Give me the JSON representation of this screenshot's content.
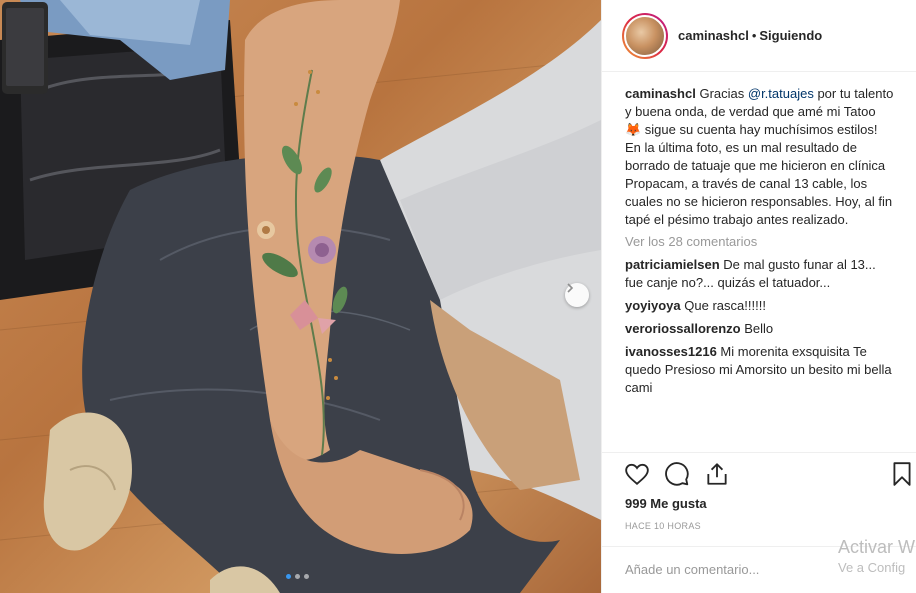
{
  "post": {
    "username": "caminashcl",
    "follow_status": "Siguiendo",
    "caption_parts": {
      "user": "caminashcl",
      "text1": "Gracias",
      "mention": "@r.tatuajes",
      "text2": "por tu talento y buena onda, de verdad que amé mi Tatoo 🦊 sigue su cuenta hay muchísimos estilos!",
      "text3": "En la última foto, es un mal resultado de borrado de tatuaje que me hicieron en clínica Propacam, a través de canal 13 cable, los cuales no se hicieron responsables. Hoy, al fin tapé el pésimo trabajo antes realizado."
    },
    "view_all": "Ver los 28 comentarios",
    "comments": [
      {
        "user": "patriciamielsen",
        "text": "De mal gusto funar al 13... fue canje no?... quizás el tatuador..."
      },
      {
        "user": "yoyiyoya",
        "text": "Que rasca!!!!!!"
      },
      {
        "user": "veroriossallorenzo",
        "text": "Bello"
      },
      {
        "user": "ivanosses1216",
        "text": "Mi morenita exsquisita Te quedo Presioso mi Amorsito un besito mi bella cami"
      }
    ],
    "likes": "999 Me gusta",
    "time_ago": "HACE 10 HORAS",
    "comment_placeholder": "Añade un comentario..."
  },
  "icons": [
    "heart-icon",
    "comment-icon",
    "share-icon",
    "bookmark-icon",
    "chevron-right-icon"
  ],
  "carousel": {
    "slides": 3,
    "current": 1
  },
  "watermark": {
    "line1": "Activar W",
    "line2": "Ve a Config"
  },
  "colors": {
    "accent": "#3897f0",
    "mention": "#003569",
    "muted": "#999999",
    "border": "#efefef"
  }
}
